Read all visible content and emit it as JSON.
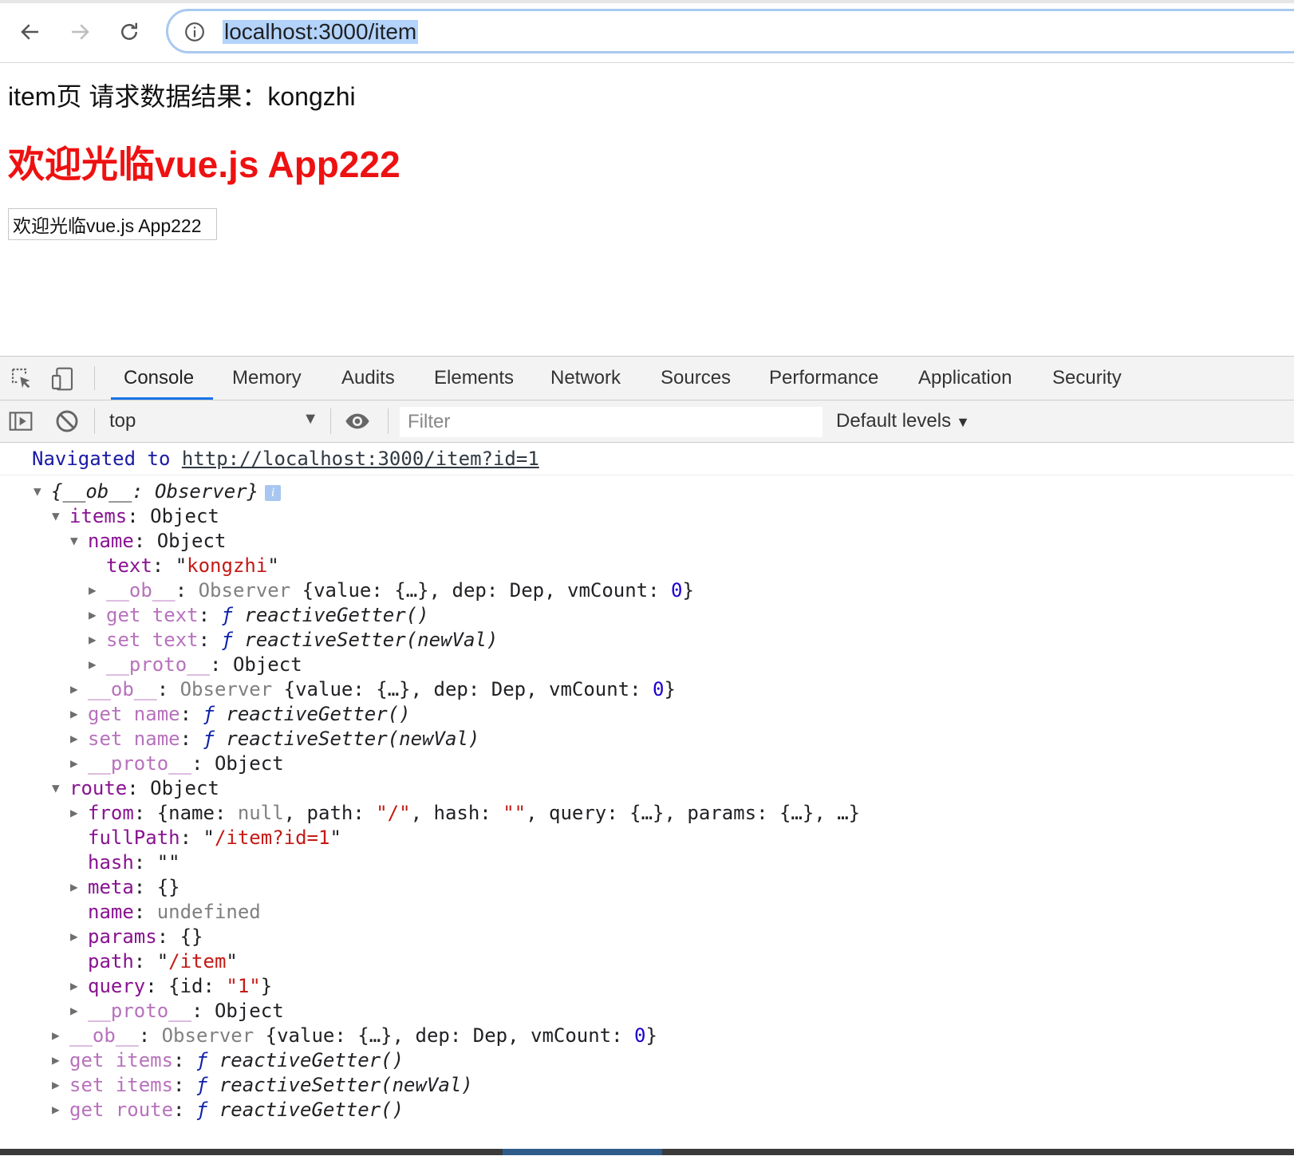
{
  "browser": {
    "url": "localhost:3000/item",
    "icons": {
      "back": "arrow-left-icon",
      "forward": "arrow-right-icon",
      "reload": "reload-icon",
      "info": "info-circle-icon"
    }
  },
  "page": {
    "text": "item页 请求数据结果：kongzhi",
    "heading": "欢迎光临vue.js App222",
    "input_value": "欢迎光临vue.js App222",
    "heading_color": "#ee1111"
  },
  "devtools": {
    "tabs": [
      "Console",
      "Memory",
      "Audits",
      "Elements",
      "Network",
      "Sources",
      "Performance",
      "Application",
      "Security"
    ],
    "active_tab": "Console",
    "accent_color": "#1a73e8",
    "context": "top",
    "filter_placeholder": "Filter",
    "levels": "Default levels",
    "console": {
      "nav_prefix": "Navigated to",
      "nav_url": "http://localhost:3000/item?id=1",
      "lines": [
        {
          "depth": 0,
          "tri": "▼",
          "segs": [
            [
              "it",
              "{__ob__: Observer}"
            ]
          ],
          "badge": "i"
        },
        {
          "depth": 1,
          "tri": "▼",
          "segs": [
            [
              "k",
              "items"
            ],
            [
              "",
              ": Object"
            ]
          ]
        },
        {
          "depth": 2,
          "tri": "▼",
          "segs": [
            [
              "k",
              "name"
            ],
            [
              "",
              ": Object"
            ]
          ]
        },
        {
          "depth": 3,
          "tri": "",
          "segs": [
            [
              "k",
              "text"
            ],
            [
              "",
              ": \""
            ],
            [
              "str",
              "kongzhi"
            ],
            [
              "",
              "\""
            ]
          ]
        },
        {
          "depth": 3,
          "tri": "▶",
          "segs": [
            [
              "kd",
              "__ob__"
            ],
            [
              "",
              ": "
            ],
            [
              "gray",
              "Observer "
            ],
            [
              "",
              "{value: {…}, dep: Dep, vmCount: "
            ],
            [
              "num",
              "0"
            ],
            [
              "",
              "}"
            ]
          ]
        },
        {
          "depth": 3,
          "tri": "▶",
          "segs": [
            [
              "kd",
              "get text"
            ],
            [
              "",
              ": "
            ],
            [
              "fkw",
              "ƒ"
            ],
            [
              "it",
              " reactiveGetter()"
            ]
          ]
        },
        {
          "depth": 3,
          "tri": "▶",
          "segs": [
            [
              "kd",
              "set text"
            ],
            [
              "",
              ": "
            ],
            [
              "fkw",
              "ƒ"
            ],
            [
              "it",
              " reactiveSetter(newVal)"
            ]
          ]
        },
        {
          "depth": 3,
          "tri": "▶",
          "segs": [
            [
              "kd",
              "__proto__"
            ],
            [
              "",
              ": Object"
            ]
          ]
        },
        {
          "depth": 2,
          "tri": "▶",
          "segs": [
            [
              "kd",
              "__ob__"
            ],
            [
              "",
              ": "
            ],
            [
              "gray",
              "Observer "
            ],
            [
              "",
              "{value: {…}, dep: Dep, vmCount: "
            ],
            [
              "num",
              "0"
            ],
            [
              "",
              "}"
            ]
          ]
        },
        {
          "depth": 2,
          "tri": "▶",
          "segs": [
            [
              "kd",
              "get name"
            ],
            [
              "",
              ": "
            ],
            [
              "fkw",
              "ƒ"
            ],
            [
              "it",
              " reactiveGetter()"
            ]
          ]
        },
        {
          "depth": 2,
          "tri": "▶",
          "segs": [
            [
              "kd",
              "set name"
            ],
            [
              "",
              ": "
            ],
            [
              "fkw",
              "ƒ"
            ],
            [
              "it",
              " reactiveSetter(newVal)"
            ]
          ]
        },
        {
          "depth": 2,
          "tri": "▶",
          "segs": [
            [
              "kd",
              "__proto__"
            ],
            [
              "",
              ": Object"
            ]
          ]
        },
        {
          "depth": 1,
          "tri": "▼",
          "segs": [
            [
              "k",
              "route"
            ],
            [
              "",
              ": Object"
            ]
          ]
        },
        {
          "depth": 2,
          "tri": "▶",
          "segs": [
            [
              "k",
              "from"
            ],
            [
              "",
              ": {name: "
            ],
            [
              "gray",
              "null"
            ],
            [
              "",
              ", path: "
            ],
            [
              "str",
              "\"/\""
            ],
            [
              "",
              ", hash: "
            ],
            [
              "str",
              "\"\""
            ],
            [
              "",
              ", query: {…}, params: {…}, …}"
            ]
          ]
        },
        {
          "depth": 2,
          "tri": "",
          "segs": [
            [
              "k",
              "fullPath"
            ],
            [
              "",
              ": \""
            ],
            [
              "str",
              "/item?id=1"
            ],
            [
              "",
              "\""
            ]
          ]
        },
        {
          "depth": 2,
          "tri": "",
          "segs": [
            [
              "k",
              "hash"
            ],
            [
              "",
              ": \"\""
            ]
          ]
        },
        {
          "depth": 2,
          "tri": "▶",
          "segs": [
            [
              "k",
              "meta"
            ],
            [
              "",
              ": {}"
            ]
          ]
        },
        {
          "depth": 2,
          "tri": "",
          "segs": [
            [
              "k",
              "name"
            ],
            [
              "",
              ": "
            ],
            [
              "gray",
              "undefined"
            ]
          ]
        },
        {
          "depth": 2,
          "tri": "▶",
          "segs": [
            [
              "k",
              "params"
            ],
            [
              "",
              ": {}"
            ]
          ]
        },
        {
          "depth": 2,
          "tri": "",
          "segs": [
            [
              "k",
              "path"
            ],
            [
              "",
              ": \""
            ],
            [
              "str",
              "/item"
            ],
            [
              "",
              "\""
            ]
          ]
        },
        {
          "depth": 2,
          "tri": "▶",
          "segs": [
            [
              "k",
              "query"
            ],
            [
              "",
              ": {id: "
            ],
            [
              "str",
              "\"1\""
            ],
            [
              "",
              "}"
            ]
          ]
        },
        {
          "depth": 2,
          "tri": "▶",
          "segs": [
            [
              "kd",
              "__proto__"
            ],
            [
              "",
              ": Object"
            ]
          ]
        },
        {
          "depth": 1,
          "tri": "▶",
          "segs": [
            [
              "kd",
              "__ob__"
            ],
            [
              "",
              ": "
            ],
            [
              "gray",
              "Observer "
            ],
            [
              "",
              "{value: {…}, dep: Dep, vmCount: "
            ],
            [
              "num",
              "0"
            ],
            [
              "",
              "}"
            ]
          ]
        },
        {
          "depth": 1,
          "tri": "▶",
          "segs": [
            [
              "kd",
              "get items"
            ],
            [
              "",
              ": "
            ],
            [
              "fkw",
              "ƒ"
            ],
            [
              "it",
              " reactiveGetter()"
            ]
          ]
        },
        {
          "depth": 1,
          "tri": "▶",
          "segs": [
            [
              "kd",
              "set items"
            ],
            [
              "",
              ": "
            ],
            [
              "fkw",
              "ƒ"
            ],
            [
              "it",
              " reactiveSetter(newVal)"
            ]
          ]
        },
        {
          "depth": 1,
          "tri": "▶",
          "segs": [
            [
              "kd",
              "get route"
            ],
            [
              "",
              ": "
            ],
            [
              "fkw",
              "ƒ"
            ],
            [
              "it",
              " reactiveGetter()"
            ]
          ]
        }
      ]
    }
  }
}
